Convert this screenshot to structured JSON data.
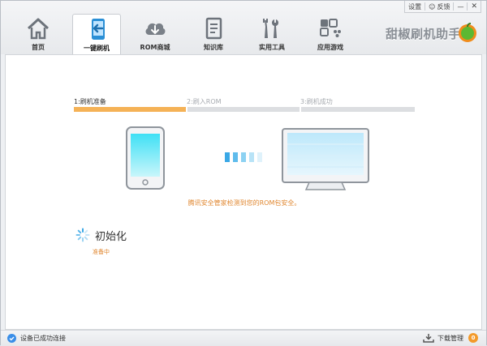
{
  "window": {
    "controls": {
      "settings": "设置",
      "feedback": "反馈",
      "feedback_glyph": "☺",
      "minimize": "—",
      "close": "✕"
    }
  },
  "tabs": [
    {
      "label": "首页",
      "icon": "home-icon",
      "active": false
    },
    {
      "label": "一键刷机",
      "icon": "flash-phone-icon",
      "active": true
    },
    {
      "label": "ROM商城",
      "icon": "cloud-download-icon",
      "active": false
    },
    {
      "label": "知识库",
      "icon": "document-icon",
      "active": false
    },
    {
      "label": "实用工具",
      "icon": "tools-icon",
      "active": false
    },
    {
      "label": "应用游戏",
      "icon": "gamepad-icon",
      "active": false
    }
  ],
  "brand": {
    "text": "甜椒刷机助手",
    "logo_icon": "pepper-logo-icon"
  },
  "steps": {
    "items": [
      "1:刷机准备",
      "2:刷入ROM",
      "3:刷机成功"
    ],
    "current": 1,
    "progress": 0.33
  },
  "notice": "腾讯安全管家检测到您的ROM包安全。",
  "init": {
    "title": "初始化",
    "subtitle": "准备中",
    "icon": "loading-spinner-icon"
  },
  "status": {
    "connection": "设备已成功连接",
    "download_label": "下载管理",
    "download_count": "0"
  },
  "colors": {
    "accent": "#f5b256",
    "notice": "#e0862e",
    "badge": "#f39a2b",
    "ok": "#3a8ee8"
  }
}
